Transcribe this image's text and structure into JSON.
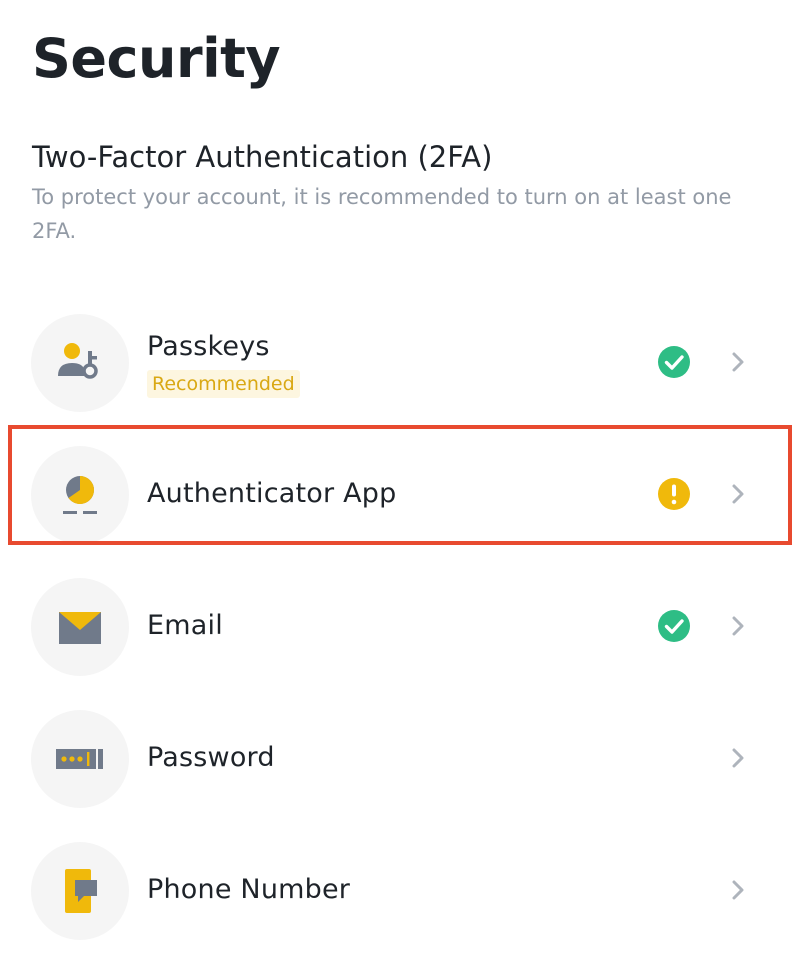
{
  "page": {
    "title": "Security"
  },
  "two_factor": {
    "title": "Two-Factor Authentication (2FA)",
    "description": "To protect your account, it is recommended to turn on at least one 2FA."
  },
  "methods": [
    {
      "label": "Passkeys",
      "badge": "Recommended",
      "icon": "passkey-icon",
      "status": "enabled",
      "status_icon": "check-circle-icon"
    },
    {
      "label": "Authenticator App",
      "icon": "authenticator-app-icon",
      "status": "warning",
      "status_icon": "warning-circle-icon",
      "highlighted": true
    },
    {
      "label": "Email",
      "icon": "envelope-icon",
      "status": "enabled",
      "status_icon": "check-circle-icon"
    },
    {
      "label": "Password",
      "icon": "password-icon",
      "status": "none"
    },
    {
      "label": "Phone Number",
      "icon": "phone-icon",
      "status": "none"
    }
  ],
  "colors": {
    "text_primary": "#1e2329",
    "text_secondary": "#929aa5",
    "accent_yellow": "#f0b90b",
    "icon_gray": "#707a8a",
    "success_green": "#2ebd85",
    "warning_yellow": "#f0b90b",
    "highlight_red": "#e84a2f",
    "badge_bg": "#fdf6e0",
    "badge_text": "#d9a814",
    "icon_circle_bg": "#f5f5f5",
    "chevron": "#aeb4bc"
  }
}
